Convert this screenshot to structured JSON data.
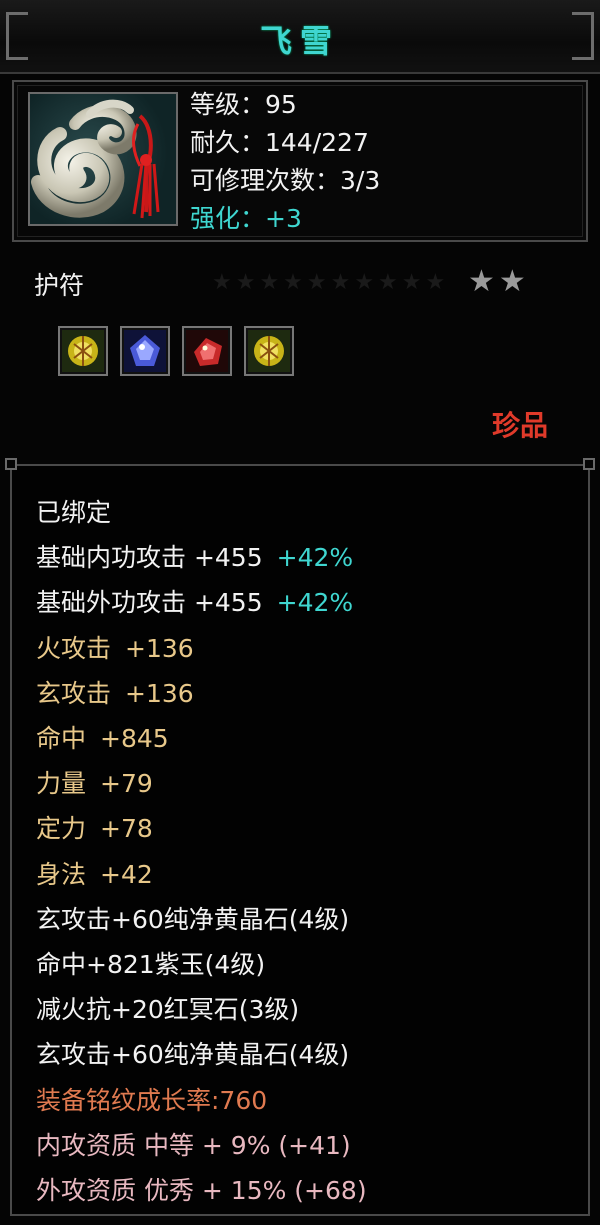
{
  "window": {
    "title": "飞雪"
  },
  "item": {
    "stats": [
      {
        "label": "等级：95"
      },
      {
        "label": "耐久：144/227"
      },
      {
        "label": "可修理次数：3/3"
      },
      {
        "label": "强化：+3"
      }
    ],
    "type": "护符",
    "stars_filled": 2,
    "rarity": "珍品",
    "gems": [
      {
        "name": "yellow-gem-icon",
        "color": "#d4c020"
      },
      {
        "name": "blue-gem-icon",
        "color": "#4a5ad8"
      },
      {
        "name": "red-gem-icon",
        "color": "#c82a2a"
      },
      {
        "name": "yellow-gem-icon",
        "color": "#d4c020"
      }
    ]
  },
  "attributes": {
    "bound": "已绑定",
    "base": [
      {
        "label": "基础内功攻击 +455",
        "bonus": "+42%"
      },
      {
        "label": "基础外功攻击 +455",
        "bonus": "+42%"
      }
    ],
    "gold": [
      {
        "name": "火攻击",
        "value": "+136"
      },
      {
        "name": "玄攻击",
        "value": "+136"
      },
      {
        "name": "命中",
        "value": "+845"
      },
      {
        "name": "力量",
        "value": "+79"
      },
      {
        "name": "定力",
        "value": "+78"
      },
      {
        "name": "身法",
        "value": "+42"
      }
    ],
    "gem_lines": [
      "玄攻击+60纯净黄晶石(4级)",
      "命中+821紫玉(4级)",
      "减火抗+20红冥石(3级)",
      "玄攻击+60纯净黄晶石(4级)"
    ],
    "growth": "装备铭纹成长率:760",
    "quality": [
      "内攻资质 中等 + 9% (+41)",
      "外攻资质 优秀 + 15% (+68)"
    ]
  },
  "colors": {
    "title": "#3fd6d0",
    "enhance": "#3fd6d0",
    "rarity": "#e03a2a",
    "gold_attr": "#e8c88a",
    "growth": "#e07a50",
    "quality": "#e8b8c0"
  }
}
